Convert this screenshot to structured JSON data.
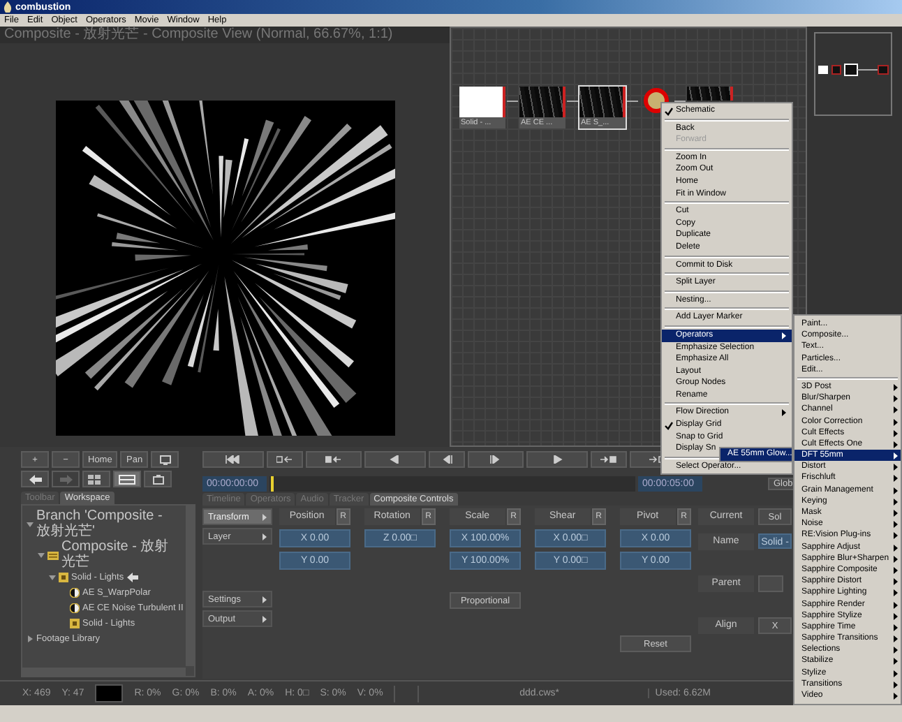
{
  "window": {
    "title": "combustion"
  },
  "menu_bar": [
    "File",
    "Edit",
    "Object",
    "Operators",
    "Movie",
    "Window",
    "Help"
  ],
  "viewer": {
    "title": "Composite - 放射光芒 - Composite View (Normal, 66.67%, 1:1)"
  },
  "schematic": {
    "nodes": [
      {
        "kind": "solid",
        "label": "Solid - ...",
        "selected": false,
        "highlighted": false
      },
      {
        "kind": "layer",
        "label": "AE CE ...",
        "selected": false,
        "highlighted": false
      },
      {
        "kind": "layer",
        "label": "AE S_...",
        "selected": true,
        "highlighted": false
      },
      {
        "kind": "operator",
        "selected": false,
        "highlighted": true
      },
      {
        "kind": "layer",
        "selected": false,
        "highlighted": false
      }
    ]
  },
  "context_menu": {
    "groups": [
      [
        {
          "label": "Schematic",
          "checked": true,
          "disabled": false,
          "selected": false,
          "submenu": false
        }
      ],
      [
        {
          "label": "Back",
          "checked": false,
          "disabled": false,
          "selected": false,
          "submenu": false
        },
        {
          "label": "Forward",
          "checked": false,
          "disabled": true,
          "selected": false,
          "submenu": false
        }
      ],
      [
        {
          "label": "Zoom In",
          "checked": false,
          "disabled": false,
          "selected": false,
          "submenu": false
        },
        {
          "label": "Zoom Out",
          "checked": false,
          "disabled": false,
          "selected": false,
          "submenu": false
        },
        {
          "label": "Home",
          "checked": false,
          "disabled": false,
          "selected": false,
          "submenu": false
        },
        {
          "label": "Fit in Window",
          "checked": false,
          "disabled": false,
          "selected": false,
          "submenu": false
        }
      ],
      [
        {
          "label": "Cut",
          "checked": false,
          "disabled": false,
          "selected": false,
          "submenu": false
        },
        {
          "label": "Copy",
          "checked": false,
          "disabled": false,
          "selected": false,
          "submenu": false
        },
        {
          "label": "Duplicate",
          "checked": false,
          "disabled": false,
          "selected": false,
          "submenu": false
        },
        {
          "label": "Delete",
          "checked": false,
          "disabled": false,
          "selected": false,
          "submenu": false
        }
      ],
      [
        {
          "label": "Commit to Disk",
          "checked": false,
          "disabled": false,
          "selected": false,
          "submenu": false
        }
      ],
      [
        {
          "label": "Split Layer",
          "checked": false,
          "disabled": false,
          "selected": false,
          "submenu": false
        }
      ],
      [
        {
          "label": "Nesting...",
          "checked": false,
          "disabled": false,
          "selected": false,
          "submenu": false
        }
      ],
      [
        {
          "label": "Add Layer Marker",
          "checked": false,
          "disabled": false,
          "selected": false,
          "submenu": false
        }
      ],
      [
        {
          "label": "Operators",
          "checked": false,
          "disabled": false,
          "selected": true,
          "submenu": true
        },
        {
          "label": "Emphasize Selection",
          "checked": false,
          "disabled": false,
          "selected": false,
          "submenu": false
        },
        {
          "label": "Emphasize All",
          "checked": false,
          "disabled": false,
          "selected": false,
          "submenu": false
        },
        {
          "label": "Layout",
          "checked": false,
          "disabled": false,
          "selected": false,
          "submenu": false
        },
        {
          "label": "Group Nodes",
          "checked": false,
          "disabled": false,
          "selected": false,
          "submenu": false
        },
        {
          "label": "Rename",
          "checked": false,
          "disabled": false,
          "selected": false,
          "submenu": false
        }
      ],
      [
        {
          "label": "Flow Direction",
          "checked": false,
          "disabled": false,
          "selected": false,
          "submenu": true
        },
        {
          "label": "Display Grid",
          "checked": true,
          "disabled": false,
          "selected": false,
          "submenu": false
        },
        {
          "label": "Snap to Grid",
          "checked": false,
          "disabled": false,
          "selected": false,
          "submenu": false
        },
        {
          "label": "Display Sn",
          "checked": false,
          "disabled": false,
          "selected": false,
          "submenu": false
        }
      ],
      [
        {
          "label": "Select Operator...",
          "checked": false,
          "disabled": false,
          "selected": false,
          "submenu": false
        }
      ]
    ]
  },
  "operators_menu": {
    "groups": [
      [
        {
          "label": "Paint...",
          "selected": false,
          "submenu": false
        },
        {
          "label": "Composite...",
          "selected": false,
          "submenu": false
        },
        {
          "label": "Text...",
          "selected": false,
          "submenu": false
        },
        {
          "label": "Particles...",
          "selected": false,
          "submenu": false
        },
        {
          "label": "Edit...",
          "selected": false,
          "submenu": false
        }
      ],
      [
        {
          "label": "3D Post",
          "selected": false,
          "submenu": true
        },
        {
          "label": "Blur/Sharpen",
          "selected": false,
          "submenu": true
        },
        {
          "label": "Channel",
          "selected": false,
          "submenu": true
        },
        {
          "label": "Color Correction",
          "selected": false,
          "submenu": true
        },
        {
          "label": "Cult Effects",
          "selected": false,
          "submenu": true
        },
        {
          "label": "Cult Effects One",
          "selected": false,
          "submenu": true
        },
        {
          "label": "DFT 55mm",
          "selected": true,
          "submenu": true
        },
        {
          "label": "Distort",
          "selected": false,
          "submenu": true
        },
        {
          "label": "Frischluft",
          "selected": false,
          "submenu": true
        },
        {
          "label": "Grain Management",
          "selected": false,
          "submenu": true
        },
        {
          "label": "Keying",
          "selected": false,
          "submenu": true
        },
        {
          "label": "Mask",
          "selected": false,
          "submenu": true
        },
        {
          "label": "Noise",
          "selected": false,
          "submenu": true
        },
        {
          "label": "RE:Vision Plug-ins",
          "selected": false,
          "submenu": true
        },
        {
          "label": "Sapphire Adjust",
          "selected": false,
          "submenu": true
        },
        {
          "label": "Sapphire Blur+Sharpen",
          "selected": false,
          "submenu": true
        },
        {
          "label": "Sapphire Composite",
          "selected": false,
          "submenu": true
        },
        {
          "label": "Sapphire Distort",
          "selected": false,
          "submenu": true
        },
        {
          "label": "Sapphire Lighting",
          "selected": false,
          "submenu": true
        },
        {
          "label": "Sapphire Render",
          "selected": false,
          "submenu": true
        },
        {
          "label": "Sapphire Stylize",
          "selected": false,
          "submenu": true
        },
        {
          "label": "Sapphire Time",
          "selected": false,
          "submenu": true
        },
        {
          "label": "Sapphire Transitions",
          "selected": false,
          "submenu": true
        },
        {
          "label": "Selections",
          "selected": false,
          "submenu": true
        },
        {
          "label": "Stabilize",
          "selected": false,
          "submenu": true
        },
        {
          "label": "Stylize",
          "selected": false,
          "submenu": true
        },
        {
          "label": "Transitions",
          "selected": false,
          "submenu": true
        },
        {
          "label": "Video",
          "selected": false,
          "submenu": true
        }
      ]
    ]
  },
  "dft_menu": {
    "items": [
      {
        "label": "AE 55mm Glow...",
        "selected": true
      }
    ]
  },
  "view_buttons": [
    "+",
    "−",
    "Home",
    "Pan"
  ],
  "timecodes": {
    "start": "00:00:00:00",
    "end": "00:00:05:00"
  },
  "global_button": "Glob",
  "left_tabs": [
    {
      "label": "Toolbar",
      "selected": false
    },
    {
      "label": "Workspace",
      "selected": true
    }
  ],
  "tree": [
    {
      "kind": "branch",
      "label": "Branch 'Composite - 放射光芒'",
      "expanded": true,
      "children": [
        {
          "kind": "composite",
          "label": "Composite - 放射光芒",
          "expanded": true,
          "children": [
            {
              "kind": "solid",
              "label": "Solid - Lights",
              "expanded": true,
              "current": true,
              "children": [
                {
                  "kind": "operator",
                  "label": "AE S_WarpPolar"
                },
                {
                  "kind": "operator",
                  "label": "AE CE Noise Turbulent II"
                },
                {
                  "kind": "solid",
                  "label": "Solid - Lights"
                }
              ]
            }
          ]
        }
      ]
    },
    {
      "kind": "branch",
      "label": "Footage Library",
      "expanded": false
    }
  ],
  "control_tabs": [
    {
      "label": "Timeline",
      "selected": false
    },
    {
      "label": "Operators",
      "selected": false
    },
    {
      "label": "Audio",
      "selected": false
    },
    {
      "label": "Tracker",
      "selected": false
    },
    {
      "label": "Composite Controls",
      "selected": true
    }
  ],
  "categories": [
    {
      "label": "Transform",
      "selected": true
    },
    {
      "label": "Layer",
      "selected": false
    },
    {
      "label": "Settings",
      "selected": false
    },
    {
      "label": "Output",
      "selected": false
    }
  ],
  "params": [
    {
      "label": "Position",
      "reset": "R",
      "values": [
        "X 0.00",
        "Y 0.00"
      ]
    },
    {
      "label": "Rotation",
      "reset": "R",
      "values": [
        "Z 0.00□"
      ]
    },
    {
      "label": "Scale",
      "reset": "R",
      "values": [
        "X 100.00%",
        "Y 100.00%"
      ],
      "button": "Proportional"
    },
    {
      "label": "Shear",
      "reset": "R",
      "values": [
        "X 0.00□",
        "Y 0.00□"
      ]
    },
    {
      "label": "Pivot",
      "reset": "R",
      "values": [
        "X 0.00",
        "Y 0.00"
      ]
    }
  ],
  "reset_button": "Reset",
  "layer_info": [
    {
      "label": "Current",
      "kind": "button",
      "value": "Sol"
    },
    {
      "label": "Name",
      "kind": "field",
      "value": "Solid -"
    },
    {
      "label": "Parent",
      "kind": "empty"
    },
    {
      "label": "Align",
      "kind": "button",
      "value": "X"
    }
  ],
  "status_bar": {
    "coords": [
      "X:  469",
      "Y:  47"
    ],
    "channels": [
      "R: 0%",
      "G: 0%",
      "B: 0%",
      "A: 0%",
      "H: 0□",
      "S: 0%",
      "V: 0%"
    ],
    "file": "ddd.cws*",
    "memory": "Used: 6.62M"
  }
}
